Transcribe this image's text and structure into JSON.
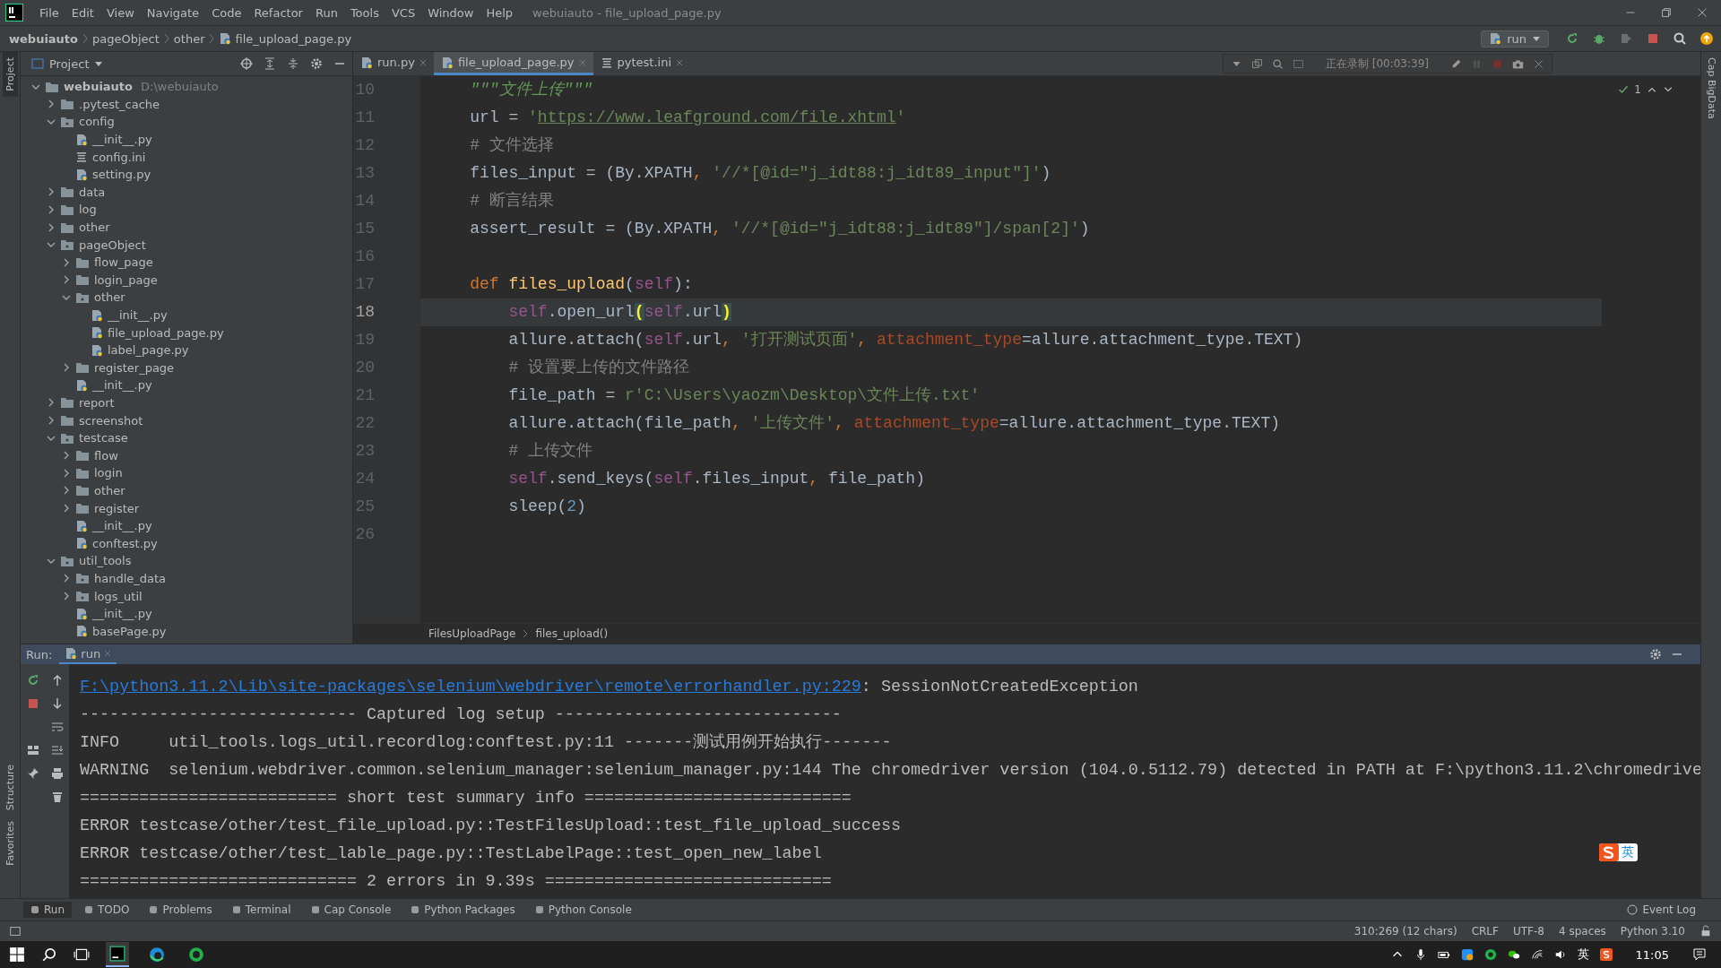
{
  "menu_bar": {
    "items": [
      "File",
      "Edit",
      "View",
      "Navigate",
      "Code",
      "Refactor",
      "Run",
      "Tools",
      "VCS",
      "Window",
      "Help"
    ],
    "title": "webuiauto - file_upload_page.py"
  },
  "nav_bar": {
    "breadcrumbs": [
      "webuiauto",
      "pageObject",
      "other",
      "file_upload_page.py"
    ],
    "run_config": "run"
  },
  "side_stripes": {
    "left_top": {
      "label": "Project",
      "selected": true
    },
    "left_bottom": [
      {
        "label": "Structure",
        "selected": false
      },
      {
        "label": "Favorites",
        "selected": false
      }
    ],
    "right": {
      "label": "Cap BigData",
      "selected": false
    }
  },
  "project_panel": {
    "title": "Project",
    "tree": [
      {
        "name": "webuiauto",
        "kind": "folder",
        "path": "D:\\webuiauto",
        "expanded": true,
        "children": [
          {
            "name": ".pytest_cache",
            "kind": "folder",
            "expanded": false
          },
          {
            "name": "config",
            "kind": "package",
            "expanded": true,
            "children": [
              {
                "name": "__init__.py",
                "kind": "python"
              },
              {
                "name": "config.ini",
                "kind": "ini"
              },
              {
                "name": "setting.py",
                "kind": "python"
              }
            ]
          },
          {
            "name": "data",
            "kind": "folder",
            "expanded": false
          },
          {
            "name": "log",
            "kind": "folder",
            "expanded": false
          },
          {
            "name": "other",
            "kind": "folder",
            "expanded": false
          },
          {
            "name": "pageObject",
            "kind": "package",
            "expanded": true,
            "children": [
              {
                "name": "flow_page",
                "kind": "folder",
                "expanded": false
              },
              {
                "name": "login_page",
                "kind": "folder",
                "expanded": false
              },
              {
                "name": "other",
                "kind": "package",
                "expanded": true,
                "children": [
                  {
                    "name": "__init__.py",
                    "kind": "python"
                  },
                  {
                    "name": "file_upload_page.py",
                    "kind": "python"
                  },
                  {
                    "name": "label_page.py",
                    "kind": "python"
                  }
                ]
              },
              {
                "name": "register_page",
                "kind": "folder",
                "expanded": false
              },
              {
                "name": "__init__.py",
                "kind": "python"
              }
            ]
          },
          {
            "name": "report",
            "kind": "folder",
            "expanded": false
          },
          {
            "name": "screenshot",
            "kind": "folder",
            "expanded": false
          },
          {
            "name": "testcase",
            "kind": "package",
            "expanded": true,
            "children": [
              {
                "name": "flow",
                "kind": "folder",
                "expanded": false
              },
              {
                "name": "login",
                "kind": "folder",
                "expanded": false
              },
              {
                "name": "other",
                "kind": "folder",
                "expanded": false
              },
              {
                "name": "register",
                "kind": "folder",
                "expanded": false
              },
              {
                "name": "__init__.py",
                "kind": "python"
              },
              {
                "name": "conftest.py",
                "kind": "python"
              }
            ]
          },
          {
            "name": "util_tools",
            "kind": "package",
            "expanded": true,
            "children": [
              {
                "name": "handle_data",
                "kind": "package",
                "expanded": false
              },
              {
                "name": "logs_util",
                "kind": "package",
                "expanded": false
              },
              {
                "name": "__init__.py",
                "kind": "python"
              },
              {
                "name": "basePage.py",
                "kind": "python"
              }
            ]
          }
        ]
      }
    ]
  },
  "editor": {
    "tabs": [
      {
        "label": "run.py",
        "kind": "python",
        "selected": false
      },
      {
        "label": "file_upload_page.py",
        "kind": "python",
        "selected": true
      },
      {
        "label": "pytest.ini",
        "kind": "ini",
        "selected": false
      }
    ],
    "recorder": {
      "status": "正在录制 [00:03:39]"
    },
    "inspection_count": "1",
    "lines": [
      {
        "number": "10",
        "kind": "class_body",
        "current": false,
        "tokens": [
          {
            "kind": "doc",
            "text": "\"\"\"文件上传\"\"\""
          }
        ]
      },
      {
        "number": "11",
        "kind": "class_body",
        "current": false,
        "tokens": [
          {
            "kind": "plain",
            "text": "url = "
          },
          {
            "kind": "str",
            "text": "'"
          },
          {
            "kind": "url",
            "text": "https://www.leafground.com/file.xhtml"
          },
          {
            "kind": "str",
            "text": "'"
          }
        ]
      },
      {
        "number": "12",
        "kind": "class_body",
        "current": false,
        "tokens": [
          {
            "kind": "comment",
            "text": "# 文件选择"
          }
        ]
      },
      {
        "number": "13",
        "kind": "class_body",
        "current": false,
        "tokens": [
          {
            "kind": "plain",
            "text": "files_input = (By.XPATH"
          },
          {
            "kind": "punct",
            "text": ", "
          },
          {
            "kind": "str",
            "text": "'//*[@id=\"j_idt88:j_idt89_input\"]'"
          },
          {
            "kind": "plain",
            "text": ")"
          }
        ]
      },
      {
        "number": "14",
        "kind": "class_body",
        "current": false,
        "tokens": [
          {
            "kind": "comment",
            "text": "# 断言结果"
          }
        ]
      },
      {
        "number": "15",
        "kind": "class_body",
        "current": false,
        "tokens": [
          {
            "kind": "plain",
            "text": "assert_result = (By.XPATH"
          },
          {
            "kind": "punct",
            "text": ", "
          },
          {
            "kind": "str",
            "text": "'//*[@id=\"j_idt88:j_idt89\"]/span[2]'"
          },
          {
            "kind": "plain",
            "text": ")"
          }
        ]
      },
      {
        "number": "16",
        "current": false
      },
      {
        "number": "17",
        "kind": "class_body",
        "current": false,
        "tokens": [
          {
            "kind": "keyword",
            "text": "def "
          },
          {
            "kind": "function",
            "text": "files_upload"
          },
          {
            "kind": "plain",
            "text": "("
          },
          {
            "kind": "self",
            "text": "self"
          },
          {
            "kind": "plain",
            "text": "):"
          }
        ]
      },
      {
        "number": "18",
        "kind": "method_body",
        "current": true,
        "tokens": [
          {
            "kind": "self",
            "text": "self"
          },
          {
            "kind": "plain",
            "text": ".open_url"
          },
          {
            "kind": "brace",
            "text": "("
          },
          {
            "kind": "self",
            "text": "self"
          },
          {
            "kind": "plain",
            "text": ".url"
          },
          {
            "kind": "brace",
            "text": ")"
          }
        ]
      },
      {
        "number": "19",
        "kind": "method_body",
        "current": false,
        "tokens": [
          {
            "kind": "plain",
            "text": "allure.attach("
          },
          {
            "kind": "self",
            "text": "self"
          },
          {
            "kind": "plain",
            "text": ".url"
          },
          {
            "kind": "punct",
            "text": ", "
          },
          {
            "kind": "str",
            "text": "'打开测试页面'"
          },
          {
            "kind": "punct",
            "text": ", "
          },
          {
            "kind": "kwarg",
            "text": "attachment_type"
          },
          {
            "kind": "plain",
            "text": "=allure.attachment_type.TEXT)"
          }
        ]
      },
      {
        "number": "20",
        "kind": "method_body",
        "current": false,
        "tokens": [
          {
            "kind": "comment",
            "text": "# 设置要上传的文件路径"
          }
        ]
      },
      {
        "number": "21",
        "kind": "method_body",
        "current": false,
        "tokens": [
          {
            "kind": "plain",
            "text": "file_path = "
          },
          {
            "kind": "str",
            "text": "r'C:\\Users\\yaozm\\Desktop\\文件上传.txt'"
          }
        ]
      },
      {
        "number": "22",
        "kind": "method_body",
        "current": false,
        "tokens": [
          {
            "kind": "plain",
            "text": "allure.attach(file_path"
          },
          {
            "kind": "punct",
            "text": ", "
          },
          {
            "kind": "str",
            "text": "'上传文件'"
          },
          {
            "kind": "punct",
            "text": ", "
          },
          {
            "kind": "kwarg",
            "text": "attachment_type"
          },
          {
            "kind": "plain",
            "text": "=allure.attachment_type.TEXT)"
          }
        ]
      },
      {
        "number": "23",
        "kind": "method_body",
        "current": false,
        "tokens": [
          {
            "kind": "comment",
            "text": "# 上传文件"
          }
        ]
      },
      {
        "number": "24",
        "kind": "method_body",
        "current": false,
        "tokens": [
          {
            "kind": "self",
            "text": "self"
          },
          {
            "kind": "plain",
            "text": ".send_keys("
          },
          {
            "kind": "self",
            "text": "self"
          },
          {
            "kind": "plain",
            "text": ".files_input"
          },
          {
            "kind": "punct",
            "text": ", "
          },
          {
            "kind": "plain",
            "text": "file_path)"
          }
        ]
      },
      {
        "number": "25",
        "kind": "method_body",
        "current": false,
        "tokens": [
          {
            "kind": "plain",
            "text": "sleep("
          },
          {
            "kind": "number",
            "text": "2"
          },
          {
            "kind": "plain",
            "text": ")"
          }
        ]
      },
      {
        "number": "26",
        "current": false
      }
    ],
    "breadcrumbs": [
      "FilesUploadPage",
      "files_upload()"
    ]
  },
  "run_panel": {
    "label": "Run:",
    "tabs": [
      {
        "label": "run",
        "selected": true
      }
    ],
    "lines": [
      [
        {
          "kind": "link",
          "text": "F:\\python3.11.2\\Lib\\site-packages\\selenium\\webdriver\\remote\\errorhandler.py:229"
        },
        {
          "kind": "plain",
          "text": ": SessionNotCreatedException"
        }
      ],
      [
        {
          "kind": "plain",
          "text": "---------------------------- Captured log setup -----------------------------"
        }
      ],
      [
        {
          "kind": "plain",
          "text": "INFO     util_tools.logs_util.recordlog:conftest.py:11 -------测试用例开始执行-------"
        }
      ],
      [
        {
          "kind": "plain",
          "text": "WARNING  selenium.webdriver.common.selenium_manager:selenium_manager.py:144 The chromedriver version (104.0.5112.79) detected in PATH at F:\\python3.11.2\\chromedrive"
        }
      ],
      [
        {
          "kind": "plain",
          "text": "========================== short test summary info ==========================="
        }
      ],
      [
        {
          "kind": "plain",
          "text": "ERROR testcase/other/test_file_upload.py::TestFilesUpload::test_file_upload_success"
        }
      ],
      [
        {
          "kind": "plain",
          "text": "ERROR testcase/other/test_lable_page.py::TestLabelPage::test_open_new_label"
        }
      ],
      [
        {
          "kind": "plain",
          "text": "============================ 2 errors in 9.39s ============================="
        }
      ]
    ],
    "ime_badge": "英"
  },
  "tool_tabs": {
    "items": [
      {
        "label": "Run",
        "selected": true
      },
      {
        "label": "TODO",
        "selected": false
      },
      {
        "label": "Problems",
        "selected": false
      },
      {
        "label": "Terminal",
        "selected": false
      },
      {
        "label": "Cap Console",
        "selected": false
      },
      {
        "label": "Python Packages",
        "selected": false
      },
      {
        "label": "Python Console",
        "selected": false
      }
    ],
    "event_log": "Event Log"
  },
  "status_bar": {
    "items": [
      "310:269 (12 chars)",
      "CRLF",
      "UTF-8",
      "4 spaces",
      "Python 3.10"
    ]
  },
  "taskbar": {
    "tray_language": "英",
    "clock": "11:05"
  }
}
